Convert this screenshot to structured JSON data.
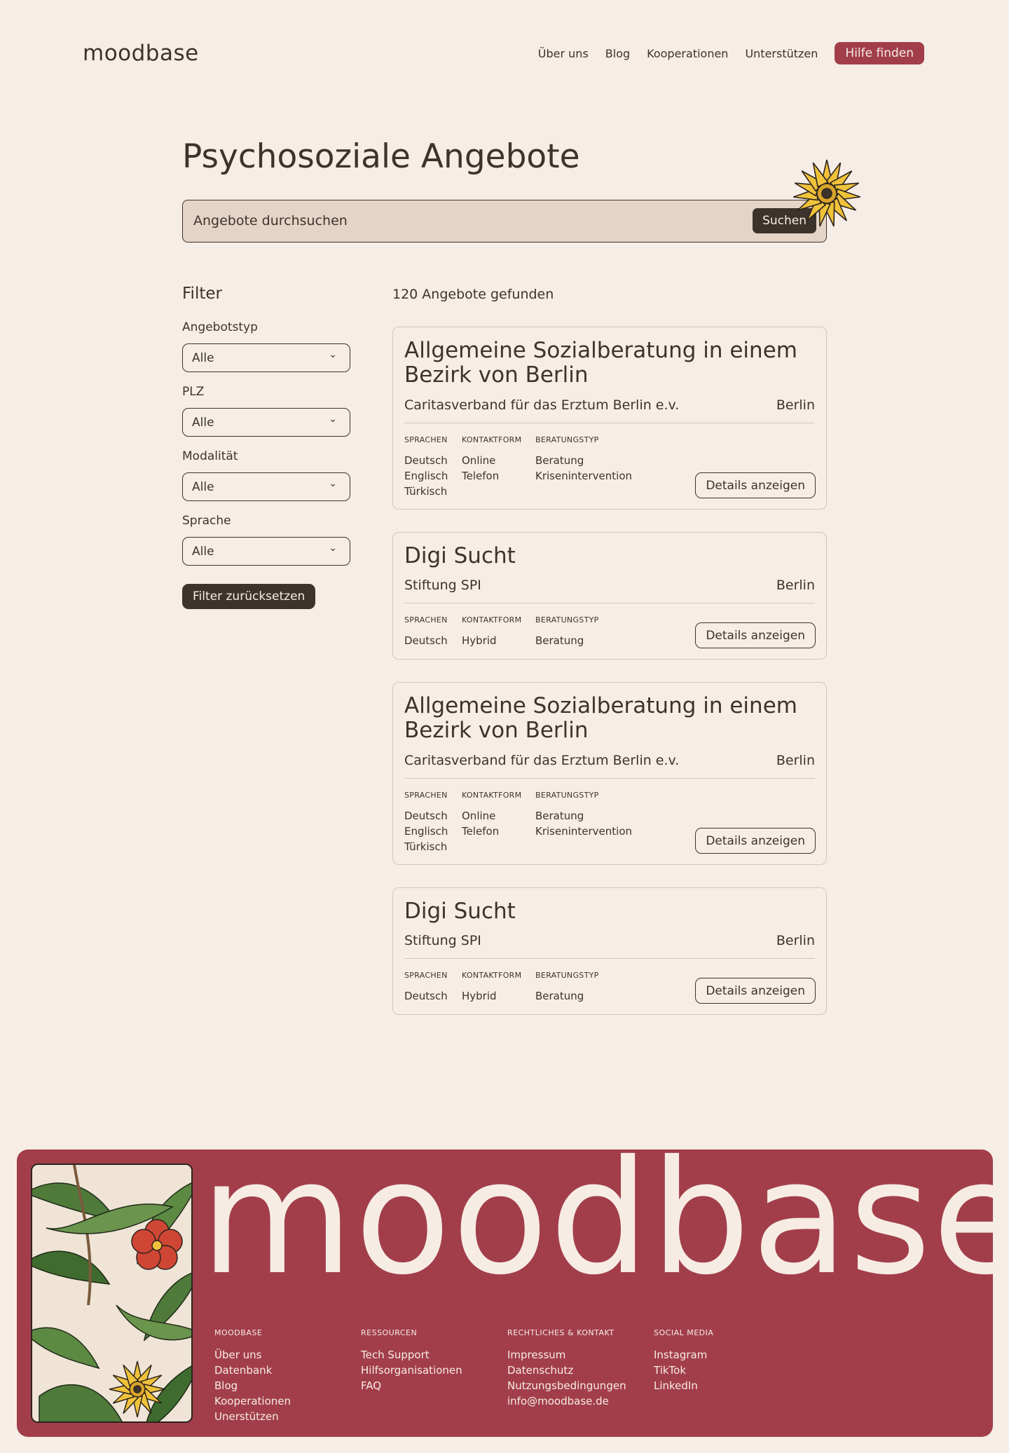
{
  "header": {
    "logo": "moodbase",
    "nav": [
      {
        "label": "Über uns"
      },
      {
        "label": "Blog"
      },
      {
        "label": "Kooperationen"
      },
      {
        "label": "Unterstützen"
      }
    ],
    "cta_label": "Hilfe finden"
  },
  "main": {
    "title": "Psychosoziale Angebote",
    "search": {
      "placeholder": "Angebote durchsuchen",
      "button_label": "Suchen"
    },
    "result_count": "120 Angebote gefunden"
  },
  "filters": {
    "title": "Filter",
    "groups": [
      {
        "label": "Angebotstyp",
        "value": "Alle"
      },
      {
        "label": "PLZ",
        "value": "Alle"
      },
      {
        "label": "Modalität",
        "value": "Alle"
      },
      {
        "label": "Sprache",
        "value": "Alle"
      }
    ],
    "reset_label": "Filter zurücksetzen"
  },
  "meta_headers": {
    "languages": "SPRACHEN",
    "contact": "KONTAKTFORM",
    "type": "BERATUNGSTYP"
  },
  "cards": [
    {
      "title": "Allgemeine Sozialberatung in einem Bezirk von Berlin",
      "org": "Caritasverband für das Erztum Berlin e.v.",
      "city": "Berlin",
      "languages": [
        "Deutsch",
        "Englisch",
        "Türkisch"
      ],
      "contact": [
        "Online",
        "Telefon"
      ],
      "type": [
        "Beratung",
        "Krisenintervention"
      ],
      "details_label": "Details anzeigen"
    },
    {
      "title": "Digi Sucht",
      "org": "Stiftung SPI",
      "city": "Berlin",
      "languages": [
        "Deutsch"
      ],
      "contact": [
        "Hybrid"
      ],
      "type": [
        "Beratung"
      ],
      "details_label": "Details anzeigen"
    },
    {
      "title": "Allgemeine Sozialberatung in einem Bezirk von Berlin",
      "org": "Caritasverband für das Erztum Berlin e.v.",
      "city": "Berlin",
      "languages": [
        "Deutsch",
        "Englisch",
        "Türkisch"
      ],
      "contact": [
        "Online",
        "Telefon"
      ],
      "type": [
        "Beratung",
        "Krisenintervention"
      ],
      "details_label": "Details anzeigen"
    },
    {
      "title": "Digi Sucht",
      "org": "Stiftung SPI",
      "city": "Berlin",
      "languages": [
        "Deutsch"
      ],
      "contact": [
        "Hybrid"
      ],
      "type": [
        "Beratung"
      ],
      "details_label": "Details anzeigen"
    }
  ],
  "footer": {
    "wordmark": "moodbase",
    "columns": [
      {
        "title": "MOODBASE",
        "links": [
          "Über uns",
          "Datenbank",
          "Blog",
          "Kooperationen",
          "Unerstützen"
        ]
      },
      {
        "title": "RESSOURCEN",
        "links": [
          "Tech Support",
          "Hilfsorganisationen",
          "FAQ"
        ]
      },
      {
        "title": "RECHTLICHES & KONTAKT",
        "links": [
          "Impressum",
          "Datenschutz",
          "Nutzungsbedingungen",
          "info@moodbase.de"
        ]
      },
      {
        "title": "SOCIAL MEDIA",
        "links": [
          "Instagram",
          "TikTok",
          "LinkedIn"
        ]
      }
    ]
  },
  "colors": {
    "background": "#f5ede6",
    "text": "#3d332d",
    "accent": "#a23e4a",
    "search_bg": "#e5d4c6"
  }
}
